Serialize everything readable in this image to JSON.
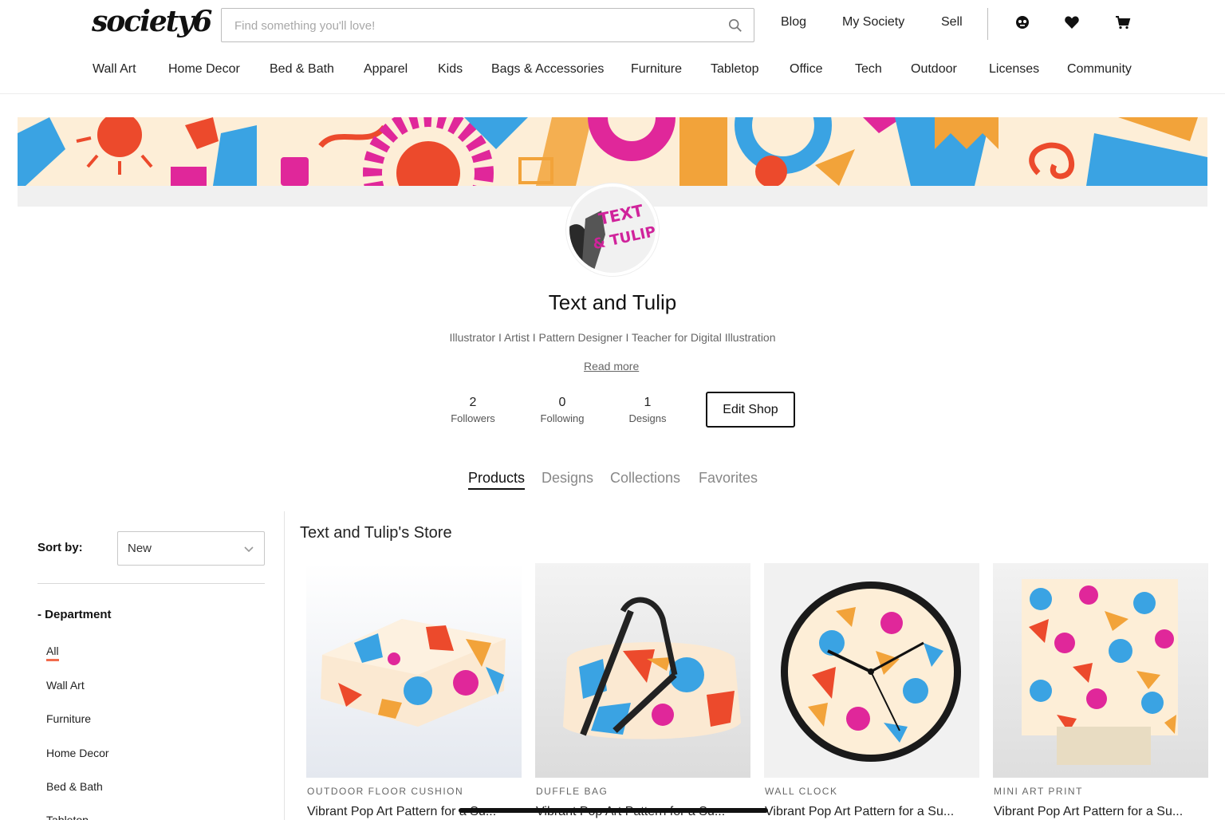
{
  "header": {
    "logo": "society6",
    "search_placeholder": "Find something you'll love!",
    "links": [
      "Blog",
      "My Society",
      "Sell"
    ]
  },
  "categories": [
    "Wall Art",
    "Home Decor",
    "Bed & Bath",
    "Apparel",
    "Kids",
    "Bags & Accessories",
    "Furniture",
    "Tabletop",
    "Office",
    "Tech",
    "Outdoor",
    "Licenses",
    "Community"
  ],
  "profile": {
    "avatar_text": "TEXT & TULIP",
    "name": "Text and Tulip",
    "bio": "Illustrator I Artist I Pattern Designer I Teacher for Digital Illustration",
    "read_more": "Read more",
    "stats": [
      {
        "value": "2",
        "label": "Followers"
      },
      {
        "value": "0",
        "label": "Following"
      },
      {
        "value": "1",
        "label": "Designs"
      }
    ],
    "edit_shop": "Edit Shop"
  },
  "tabs": [
    "Products",
    "Designs",
    "Collections",
    "Favorites"
  ],
  "sidebar": {
    "sort_label": "Sort by:",
    "sort_value": "New",
    "department_title": "- Department",
    "departments": [
      "All",
      "Wall Art",
      "Furniture",
      "Home Decor",
      "Bed & Bath",
      "Tabletop"
    ]
  },
  "store": {
    "title": "Text and Tulip's Store",
    "products": [
      {
        "type": "OUTDOOR FLOOR CUSHION",
        "title": "Vibrant Pop Art Pattern for a Su..."
      },
      {
        "type": "DUFFLE BAG",
        "title": "Vibrant Pop Art Pattern for a Su..."
      },
      {
        "type": "WALL CLOCK",
        "title": "Vibrant Pop Art Pattern for a Su..."
      },
      {
        "type": "MINI ART PRINT",
        "title": "Vibrant Pop Art Pattern for a Su..."
      }
    ]
  },
  "colors": {
    "accent": "#f26b4c",
    "pattern_blue": "#3aa3e3",
    "pattern_magenta": "#e0279a",
    "pattern_orange": "#f2a33a",
    "pattern_red": "#ec4a2c",
    "pattern_cream": "#fdeed7"
  }
}
